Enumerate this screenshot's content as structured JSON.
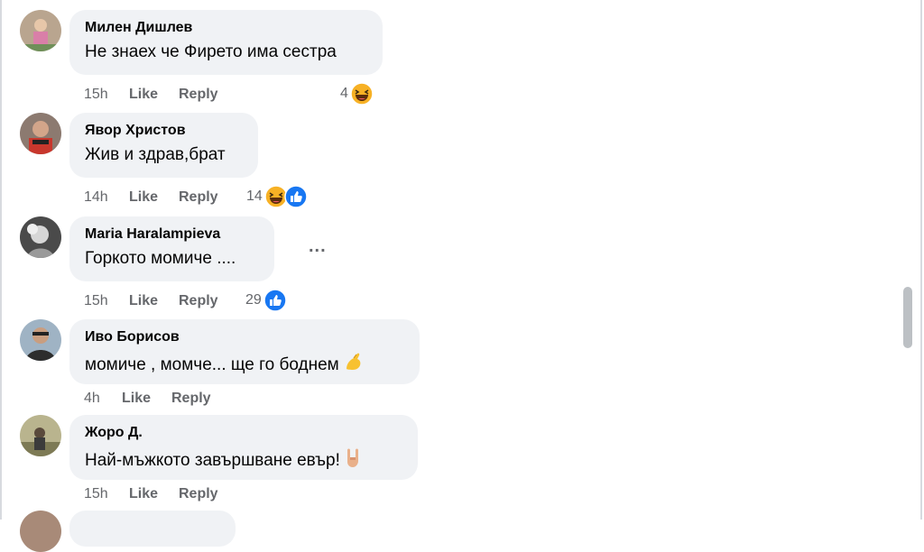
{
  "comments": [
    {
      "author": "Милен Дишлев",
      "text": "Не знаех че Фирето има сестра",
      "time": "15h",
      "like_label": "Like",
      "reply_label": "Reply",
      "reaction_count": "4",
      "reactions": [
        "haha-icon"
      ],
      "avatar_color": "#8a6f5a"
    },
    {
      "author": "Явор Христов",
      "text": "Жив и здрав,брат",
      "time": "14h",
      "like_label": "Like",
      "reply_label": "Reply",
      "reaction_count": "14",
      "reactions": [
        "haha-icon",
        "like-icon"
      ],
      "avatar_color": "#5b3a32"
    },
    {
      "author": "Maria Haralampieva",
      "text": "Горкото момиче ....",
      "time": "15h",
      "like_label": "Like",
      "reply_label": "Reply",
      "reaction_count": "29",
      "reactions": [
        "like-icon"
      ],
      "more_label": "...",
      "avatar_color": "#6e6e6e"
    },
    {
      "author": "Иво Борисов",
      "text": "момиче , момче... ще го боднем",
      "text_emoji": "pinched-fingers-icon",
      "time": "4h",
      "like_label": "Like",
      "reply_label": "Reply",
      "avatar_color": "#3f4a52"
    },
    {
      "author": "Жоро Д.",
      "text": "Най-мъжкото завършване евър!",
      "text_emoji": "sign-of-horns-icon",
      "time": "15h",
      "like_label": "Like",
      "reply_label": "Reply",
      "avatar_color": "#8d8a6a"
    }
  ],
  "colors": {
    "bubble": "#f0f2f5",
    "secondary_text": "#65676b",
    "like_blue": "#1877f2",
    "haha_yellow": "#f7b125"
  }
}
